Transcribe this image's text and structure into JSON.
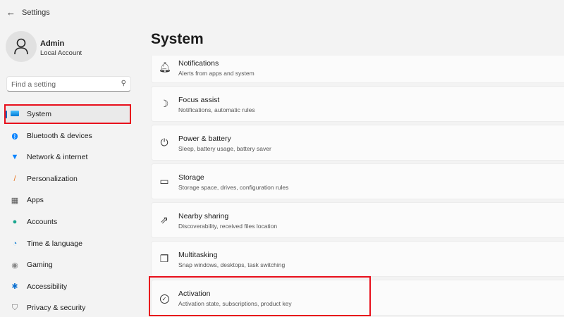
{
  "app": {
    "title": "Settings"
  },
  "user": {
    "name": "Admin",
    "account": "Local Account"
  },
  "search": {
    "placeholder": "Find a setting"
  },
  "sidebar": {
    "items": [
      {
        "label": "System",
        "icon": "monitor-icon",
        "selected": true
      },
      {
        "label": "Bluetooth & devices",
        "icon": "bluetooth-icon"
      },
      {
        "label": "Network & internet",
        "icon": "wifi-icon"
      },
      {
        "label": "Personalization",
        "icon": "brush-icon"
      },
      {
        "label": "Apps",
        "icon": "apps-icon"
      },
      {
        "label": "Accounts",
        "icon": "person-icon"
      },
      {
        "label": "Time & language",
        "icon": "clock-globe-icon"
      },
      {
        "label": "Gaming",
        "icon": "gamepad-icon"
      },
      {
        "label": "Accessibility",
        "icon": "accessibility-icon"
      },
      {
        "label": "Privacy & security",
        "icon": "shield-icon"
      }
    ]
  },
  "main": {
    "title": "System",
    "items": [
      {
        "title": "Notifications",
        "subtitle": "Alerts from apps and system",
        "icon": "bell-icon"
      },
      {
        "title": "Focus assist",
        "subtitle": "Notifications, automatic rules",
        "icon": "moon-icon"
      },
      {
        "title": "Power & battery",
        "subtitle": "Sleep, battery usage, battery saver",
        "icon": "power-icon"
      },
      {
        "title": "Storage",
        "subtitle": "Storage space, drives, configuration rules",
        "icon": "storage-icon"
      },
      {
        "title": "Nearby sharing",
        "subtitle": "Discoverability, received files location",
        "icon": "share-icon"
      },
      {
        "title": "Multitasking",
        "subtitle": "Snap windows, desktops, task switching",
        "icon": "multitask-icon"
      },
      {
        "title": "Activation",
        "subtitle": "Activation state, subscriptions, product key",
        "icon": "check-circle-icon",
        "highlighted": true
      }
    ]
  },
  "colors": {
    "highlight": "#e8101c",
    "accent": "#0067c0"
  }
}
